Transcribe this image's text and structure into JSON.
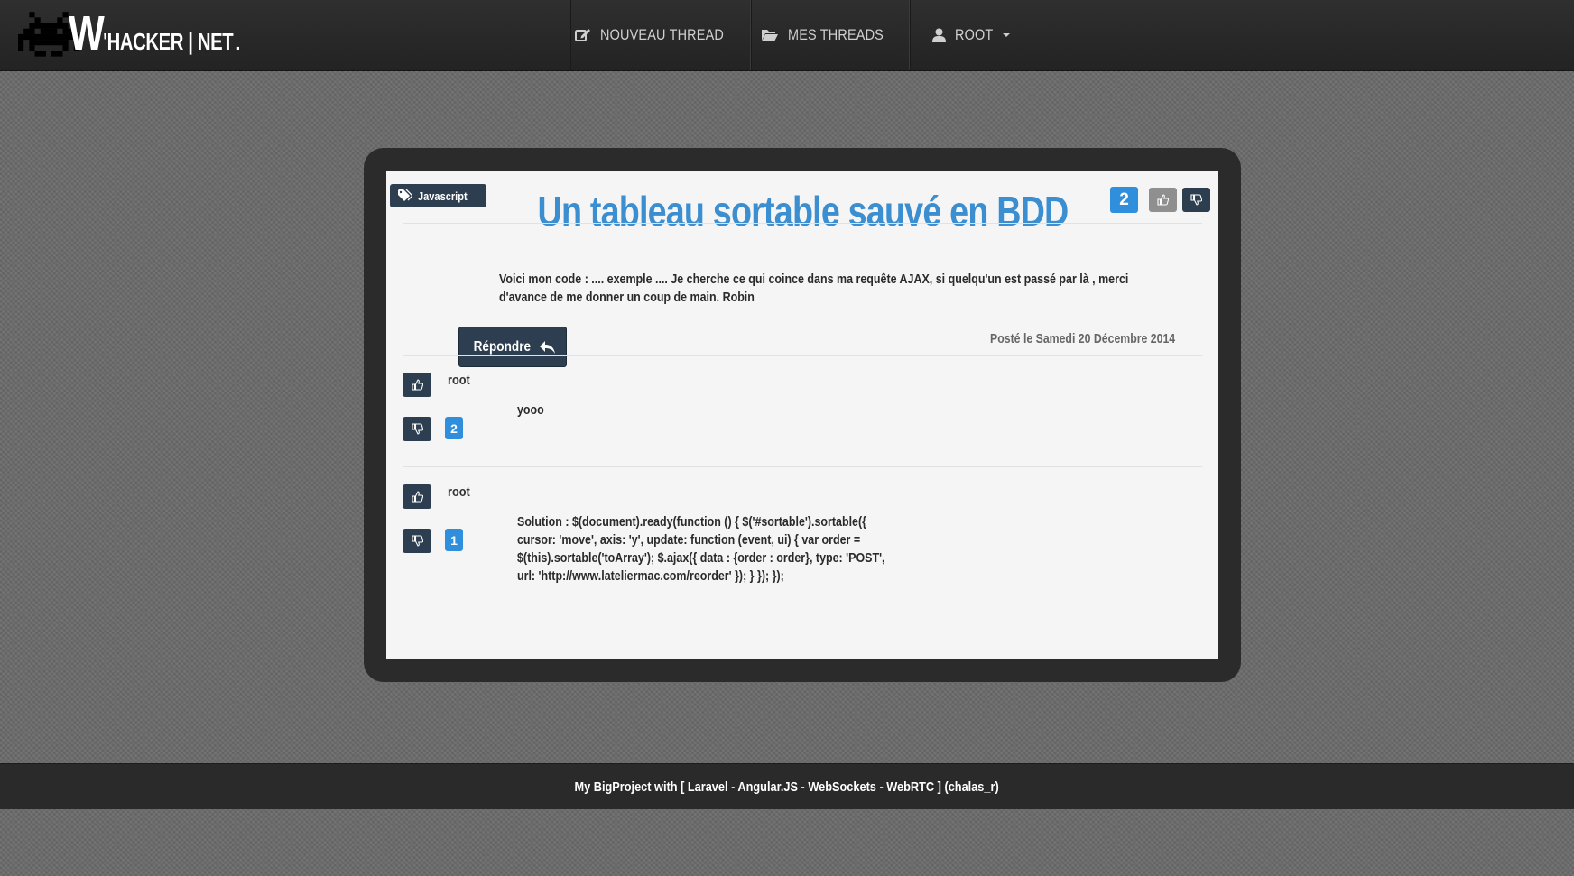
{
  "brand": {
    "letter": "W",
    "name": "'HACKER | NET",
    "suffix": "."
  },
  "nav": {
    "new_thread": "NOUVEAU THREAD",
    "my_threads": "MES THREADS",
    "user": "ROOT"
  },
  "thread": {
    "tag": "Javascript",
    "title": "Un tableau sortable sauvé en BDD",
    "score": "2",
    "body": "Voici mon code : .... exemple .... Je cherche ce qui coince dans ma requête AJAX, si quelqu'un est passé par là , merci d'avance de me donner un coup de main. Robin",
    "reply_button": "Répondre",
    "posted": "Posté le Samedi 20 Décembre 2014"
  },
  "replies": [
    {
      "author": "root",
      "score": "2",
      "text": "yooo"
    },
    {
      "author": "root",
      "score": "1",
      "text": "Solution : $(document).ready(function () { $('#sortable').sortable({ cursor: 'move', axis: 'y', update: function (event, ui) { var order = $(this).sortable('toArray'); $.ajax({ data : {order : order}, type: 'POST', url: 'http://www.lateliermac.com/reorder' }); } }); });"
    }
  ],
  "footer": {
    "text": "My BigProject with  [ Laravel - Angular.JS - WebSockets - WebRTC ]   (chalas_r)"
  },
  "colors": {
    "accent": "#3b8ed0",
    "navy": "#2c3e50",
    "badge": "#2f8fdc"
  },
  "icons": [
    "space-invader-logo",
    "edit-icon",
    "folder-open-icon",
    "user-icon",
    "tag-icon",
    "thumbs-up-icon",
    "thumbs-down-icon",
    "reply-icon"
  ]
}
